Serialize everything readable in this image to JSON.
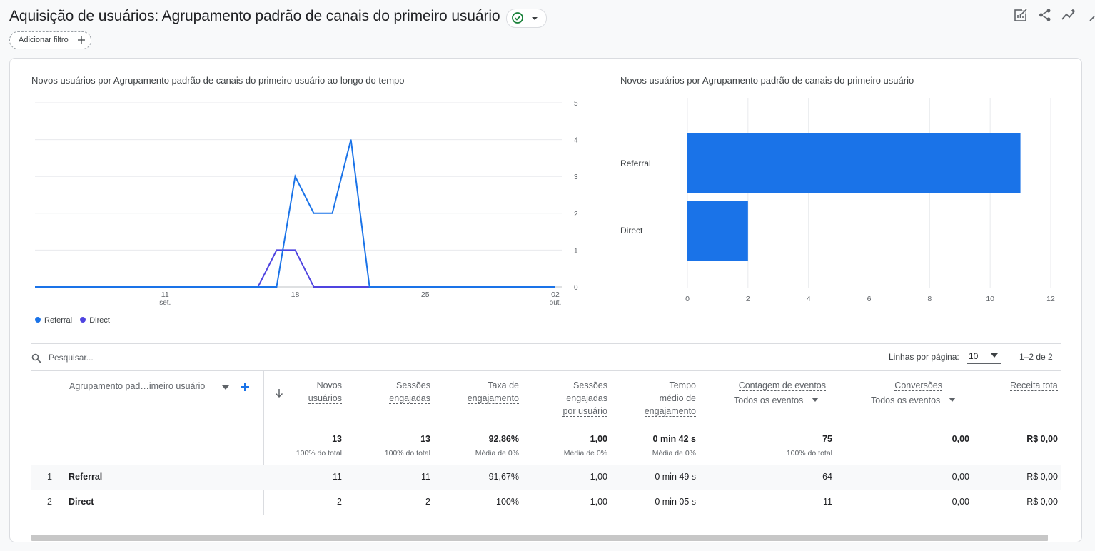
{
  "header": {
    "title": "Aquisição de usuários: Agrupamento padrão de canais do primeiro usuário",
    "add_filter_label": "Adicionar filtro"
  },
  "colors": {
    "referral": "#1a73e8",
    "direct": "#4f44e0",
    "bar": "#1a73e8",
    "accent": "#1a73e8",
    "status_ok": "#188038"
  },
  "icons": [
    "check-circle-icon",
    "chevron-down-icon",
    "plus-icon",
    "customize-report-icon",
    "share-icon",
    "insights-icon",
    "search-icon",
    "sort-down-icon"
  ],
  "chart_data": [
    {
      "type": "line",
      "title": "Novos usuários por Agrupamento padrão de canais do primeiro usuário ao longo do tempo",
      "x": [
        "2024-09-04",
        "2024-09-05",
        "2024-09-06",
        "2024-09-07",
        "2024-09-08",
        "2024-09-09",
        "2024-09-10",
        "2024-09-11",
        "2024-09-12",
        "2024-09-13",
        "2024-09-14",
        "2024-09-15",
        "2024-09-16",
        "2024-09-17",
        "2024-09-18",
        "2024-09-19",
        "2024-09-20",
        "2024-09-21",
        "2024-09-22",
        "2024-09-23",
        "2024-09-24",
        "2024-09-25",
        "2024-09-26",
        "2024-09-27",
        "2024-09-28",
        "2024-09-29",
        "2024-09-30",
        "2024-10-01",
        "2024-10-02"
      ],
      "x_ticks": [
        {
          "index": 7,
          "label": "11",
          "sub": "set."
        },
        {
          "index": 14,
          "label": "18",
          "sub": ""
        },
        {
          "index": 21,
          "label": "25",
          "sub": ""
        },
        {
          "index": 28,
          "label": "02",
          "sub": "out."
        }
      ],
      "series": [
        {
          "name": "Referral",
          "values": [
            0,
            0,
            0,
            0,
            0,
            0,
            0,
            0,
            0,
            0,
            0,
            0,
            0,
            0,
            3,
            2,
            2,
            4,
            0,
            0,
            0,
            0,
            0,
            0,
            0,
            0,
            0,
            0,
            0
          ]
        },
        {
          "name": "Direct",
          "values": [
            0,
            0,
            0,
            0,
            0,
            0,
            0,
            0,
            0,
            0,
            0,
            0,
            0,
            1,
            1,
            0,
            0,
            0,
            0,
            0,
            0,
            0,
            0,
            0,
            0,
            0,
            0,
            0,
            0
          ]
        }
      ],
      "ylim": [
        0,
        5
      ],
      "y_ticks": [
        0,
        1,
        2,
        3,
        4,
        5
      ],
      "y_axis_side": "right",
      "grid": true,
      "legend": "bottom-left"
    },
    {
      "type": "bar",
      "orientation": "horizontal",
      "title": "Novos usuários por Agrupamento padrão de canais do primeiro usuário",
      "categories": [
        "Referral",
        "Direct"
      ],
      "values": [
        11,
        2
      ],
      "xlim": [
        0,
        12
      ],
      "x_ticks": [
        0,
        2,
        4,
        6,
        8,
        10,
        12
      ],
      "grid": true
    }
  ],
  "table": {
    "search_placeholder": "Pesquisar...",
    "rows_per_page_label": "Linhas por página:",
    "rows_per_page_value": "10",
    "pagination": "1–2 de 2",
    "dimension_header": "Agrupamento pad…imeiro usuário",
    "columns": [
      {
        "l1": "Novos",
        "l2": "usuários",
        "l3": ""
      },
      {
        "l1": "Sessões",
        "l2": "engajadas",
        "l3": ""
      },
      {
        "l1": "Taxa de",
        "l2": "engajamento",
        "l3": ""
      },
      {
        "l1": "Sessões",
        "l2": "engajadas",
        "l3": "por usuário"
      },
      {
        "l1": "Tempo",
        "l2": "médio de",
        "l3": "engajamento"
      },
      {
        "l1": "Contagem de eventos",
        "dropdown": "Todos os eventos"
      },
      {
        "l1": "Conversões",
        "dropdown": "Todos os eventos"
      },
      {
        "l1": "Receita tota"
      }
    ],
    "totals": [
      {
        "value": "13",
        "sub": "100% do total"
      },
      {
        "value": "13",
        "sub": "100% do total"
      },
      {
        "value": "92,86%",
        "sub": "Média de 0%"
      },
      {
        "value": "1,00",
        "sub": "Média de 0%"
      },
      {
        "value": "0 min 42 s",
        "sub": "Média de 0%"
      },
      {
        "value": "75",
        "sub": "100% do total"
      },
      {
        "value": "0,00",
        "sub": ""
      },
      {
        "value": "R$ 0,00",
        "sub": ""
      }
    ],
    "rows": [
      {
        "index": "1",
        "name": "Referral",
        "values": [
          "11",
          "11",
          "91,67%",
          "1,00",
          "0 min 49 s",
          "64",
          "0,00",
          "R$ 0,00"
        ]
      },
      {
        "index": "2",
        "name": "Direct",
        "values": [
          "2",
          "2",
          "100%",
          "1,00",
          "0 min 05 s",
          "11",
          "0,00",
          "R$ 0,00"
        ]
      }
    ]
  }
}
